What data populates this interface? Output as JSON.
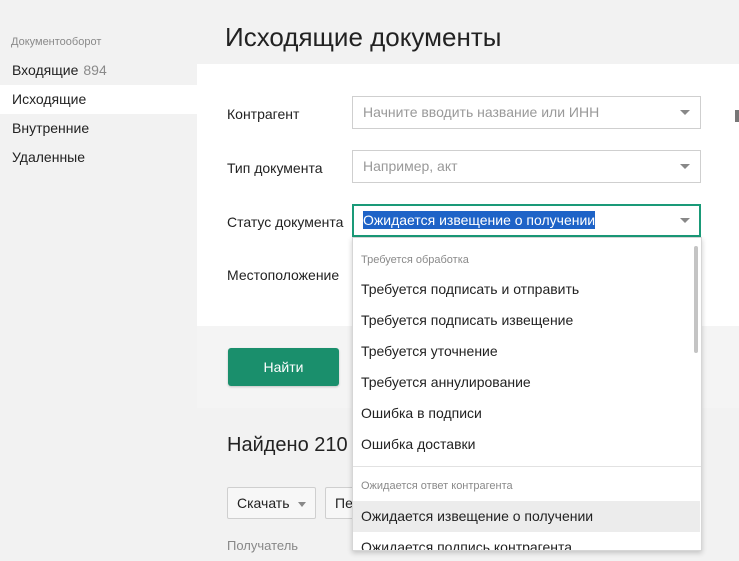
{
  "sidebar": {
    "header": "Документооборот",
    "items": [
      {
        "label": "Входящие",
        "count": "894"
      },
      {
        "label": "Исходящие"
      },
      {
        "label": "Внутренние"
      },
      {
        "label": "Удаленные"
      }
    ]
  },
  "page": {
    "title": "Исходящие документы"
  },
  "filters": {
    "counterparty": {
      "label": "Контрагент",
      "placeholder": "Начните вводить название или ИНН"
    },
    "doc_type": {
      "label": "Тип документа",
      "placeholder": "Например, акт"
    },
    "status": {
      "label": "Статус документа",
      "value": "Ожидается извещение о получении"
    },
    "location": {
      "label": "Местоположение"
    }
  },
  "find_button": "Найти",
  "results": {
    "found": "Найдено 210"
  },
  "toolbar": {
    "download": "Скачать",
    "second": "Пе"
  },
  "table": {
    "recipient_header": "Получатель"
  },
  "dropdown": {
    "groups": [
      {
        "title": "Требуется обработка",
        "items": [
          "Требуется подписать и отправить",
          "Требуется подписать извещение",
          "Требуется уточнение",
          "Требуется аннулирование",
          "Ошибка в подписи",
          "Ошибка доставки"
        ]
      },
      {
        "title": "Ожидается ответ контрагента",
        "items": [
          "Ожидается извещение о получении",
          "Ожидается подпись контрагента"
        ]
      }
    ]
  },
  "colors": {
    "accent": "#1a8f6c",
    "focus_border": "#1a9a78",
    "selection": "#1e63c7"
  }
}
